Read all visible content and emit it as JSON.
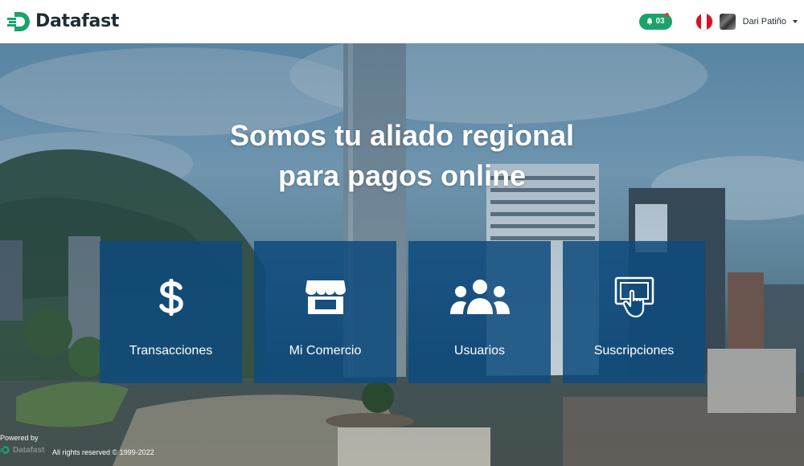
{
  "header": {
    "brand_name": "Datafast",
    "notification_count": "03",
    "user_name": "Dari Patiño",
    "colors": {
      "brand_green": "#1aa36a",
      "brand_dark": "#1f2d33"
    }
  },
  "hero": {
    "headline_line1": "Somos tu aliado regional",
    "headline_line2": "para pagos online"
  },
  "cards": [
    {
      "label": "Transacciones",
      "icon": "dollar-icon"
    },
    {
      "label": "Mi Comercio",
      "icon": "store-icon"
    },
    {
      "label": "Usuarios",
      "icon": "users-icon"
    },
    {
      "label": "Suscripciones",
      "icon": "touch-screen-icon"
    }
  ],
  "footer": {
    "powered_by": "Powered by",
    "powered_brand": "Datafast",
    "rights": "All rights reserved © 1999-2022"
  },
  "colors": {
    "card_bg": "#0e4b7d"
  }
}
